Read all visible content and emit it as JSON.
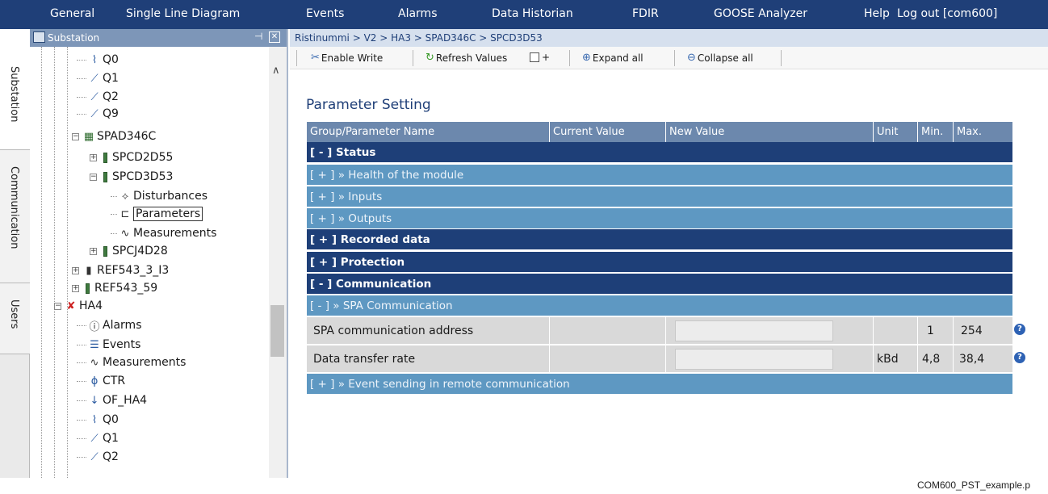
{
  "menu": {
    "items": [
      "General",
      "Single Line Diagram",
      "Events",
      "Alarms",
      "Data Historian",
      "FDIR",
      "GOOSE Analyzer",
      "Help",
      "Log out [com600]"
    ]
  },
  "side_tabs": [
    "Substation",
    "Communication",
    "Users"
  ],
  "tree_panel": {
    "title": "Substation",
    "items": [
      {
        "label": "Q0",
        "icon": "switch-icon"
      },
      {
        "label": "Q1",
        "icon": "breaker-icon"
      },
      {
        "label": "Q2",
        "icon": "breaker-icon"
      },
      {
        "label": "Q9",
        "icon": "earth-switch-icon"
      },
      {
        "label": "SPAD346C",
        "icon": "device-icon",
        "expander": "−"
      },
      {
        "label": "SPCD2D55",
        "icon": "bar-icon",
        "expander": "+"
      },
      {
        "label": "SPCD3D53",
        "icon": "bar-icon",
        "expander": "−"
      },
      {
        "label": "Disturbances",
        "icon": "disturbance-icon"
      },
      {
        "label": "Parameters",
        "icon": "parameters-icon",
        "selected": true
      },
      {
        "label": "Measurements",
        "icon": "wave-icon"
      },
      {
        "label": "SPCJ4D28",
        "icon": "bar-icon",
        "expander": "+"
      },
      {
        "label": "REF543_3_I3",
        "icon": "relay-icon",
        "expander": "+"
      },
      {
        "label": "REF543_59",
        "icon": "bar-icon",
        "expander": "+"
      },
      {
        "label": "HA4",
        "icon": "bay-error-icon",
        "expander": "−"
      },
      {
        "label": "Alarms",
        "icon": "alarm-icon"
      },
      {
        "label": "Events",
        "icon": "events-icon"
      },
      {
        "label": "Measurements",
        "icon": "wave-icon"
      },
      {
        "label": "CTR",
        "icon": "ctr-icon"
      },
      {
        "label": "OF_HA4",
        "icon": "arrow-down-icon"
      },
      {
        "label": "Q0",
        "icon": "switch-icon"
      },
      {
        "label": "Q1",
        "icon": "breaker-icon"
      },
      {
        "label": "Q2",
        "icon": "breaker-icon"
      }
    ]
  },
  "breadcrumb": "Ristinummi > V2 > HA3 > SPAD346C > SPCD3D53",
  "toolbar": {
    "enable_write": "Enable Write",
    "refresh_values": "Refresh Values",
    "refresh_plus": "+",
    "expand_all": "Expand all",
    "collapse_all": "Collapse all"
  },
  "page_title": "Parameter Setting",
  "grid": {
    "headers": [
      "Group/Parameter Name",
      "Current Value",
      "New Value",
      "Unit",
      "Min.",
      "Max."
    ],
    "rows": [
      {
        "kind": "group",
        "label": "[ - ] Status"
      },
      {
        "kind": "sub",
        "label": "[ + ] » Health of the module"
      },
      {
        "kind": "sub",
        "label": "[ + ] » Inputs"
      },
      {
        "kind": "sub",
        "label": "[ + ] » Outputs"
      },
      {
        "kind": "group",
        "label": "[ + ] Recorded data"
      },
      {
        "kind": "group",
        "label": "[ + ] Protection"
      },
      {
        "kind": "group",
        "label": "[ - ] Communication"
      },
      {
        "kind": "sub",
        "label": "[ - ] » SPA Communication"
      },
      {
        "kind": "param",
        "name": "SPA communication address",
        "current": "",
        "new_value": "",
        "unit": "",
        "min": "1",
        "max": "254"
      },
      {
        "kind": "param",
        "name": "Data transfer rate",
        "current": "",
        "new_value": "",
        "unit": "kBd",
        "min": "4,8",
        "max": "38,4"
      },
      {
        "kind": "sub",
        "label": "[ + ] » Event sending in remote communication"
      }
    ]
  },
  "caption": "COM600_PST_example.p",
  "colors": {
    "menubar": "#1f3f78",
    "group_row": "#1e3f78",
    "sub_row": "#5e98c2",
    "header": "#6c88ad",
    "param_row": "#d9d9d9"
  }
}
